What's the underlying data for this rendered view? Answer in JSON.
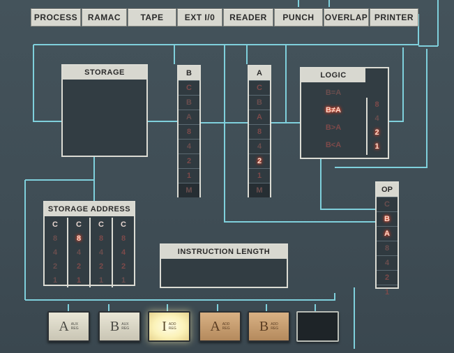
{
  "status_buttons": [
    "PROCESS",
    "RAMAC",
    "TAPE",
    "EXT I/0",
    "READER",
    "PUNCH",
    "OVERLAP",
    "PRINTER"
  ],
  "storage": {
    "label": "STORAGE"
  },
  "b_register": {
    "label": "B",
    "cells": [
      {
        "text": "C",
        "state": "off"
      },
      {
        "text": "B",
        "state": "dim"
      },
      {
        "text": "A",
        "state": "dim"
      },
      {
        "text": "8",
        "state": "off"
      },
      {
        "text": "4",
        "state": "dim"
      },
      {
        "text": "2",
        "state": "off"
      },
      {
        "text": "1",
        "state": "off"
      },
      {
        "text": "M",
        "state": "dim"
      }
    ]
  },
  "a_register": {
    "label": "A",
    "cells": [
      {
        "text": "C",
        "state": "off"
      },
      {
        "text": "B",
        "state": "dim"
      },
      {
        "text": "A",
        "state": "off"
      },
      {
        "text": "8",
        "state": "off"
      },
      {
        "text": "4",
        "state": "dim"
      },
      {
        "text": "2",
        "state": "on"
      },
      {
        "text": "1",
        "state": "off"
      },
      {
        "text": "M",
        "state": "dim"
      }
    ]
  },
  "logic": {
    "label": "LOGIC",
    "rows": [
      {
        "text": "B=A",
        "state": "dim"
      },
      {
        "text": "B≠A",
        "state": "on"
      },
      {
        "text": "B>A",
        "state": "off"
      },
      {
        "text": "B<A",
        "state": "off"
      }
    ],
    "side_cells": [
      {
        "text": "8",
        "state": "off"
      },
      {
        "text": "4",
        "state": "dim"
      },
      {
        "text": "2",
        "state": "on"
      },
      {
        "text": "1",
        "state": "on"
      }
    ]
  },
  "op": {
    "label": "OP",
    "cells": [
      {
        "text": "C",
        "state": "dim"
      },
      {
        "text": "B",
        "state": "on"
      },
      {
        "text": "A",
        "state": "on"
      },
      {
        "text": "8",
        "state": "dim"
      },
      {
        "text": "4",
        "state": "dim"
      },
      {
        "text": "2",
        "state": "off"
      },
      {
        "text": "1",
        "state": "off"
      }
    ]
  },
  "storage_address": {
    "label": "STORAGE ADDRESS",
    "columns": [
      {
        "header": "C",
        "cells": [
          {
            "text": "8",
            "state": "dim"
          },
          {
            "text": "4",
            "state": "dim"
          },
          {
            "text": "2",
            "state": "dim"
          },
          {
            "text": "1",
            "state": "dim"
          }
        ]
      },
      {
        "header": "C",
        "cells": [
          {
            "text": "8",
            "state": "on"
          },
          {
            "text": "4",
            "state": "dim"
          },
          {
            "text": "2",
            "state": "off"
          },
          {
            "text": "1",
            "state": "off"
          }
        ]
      },
      {
        "header": "C",
        "cells": [
          {
            "text": "8",
            "state": "off"
          },
          {
            "text": "4",
            "state": "dim"
          },
          {
            "text": "2",
            "state": "off"
          },
          {
            "text": "1",
            "state": "dim"
          }
        ]
      },
      {
        "header": "C",
        "cells": [
          {
            "text": "8",
            "state": "off"
          },
          {
            "text": "4",
            "state": "off"
          },
          {
            "text": "2",
            "state": "off"
          },
          {
            "text": "1",
            "state": "dim"
          }
        ]
      }
    ]
  },
  "instruction_length": {
    "label": "INSTRUCTION LENGTH"
  },
  "keys": [
    {
      "big": "A",
      "small1": "AUX",
      "small2": "REG",
      "style": "pale"
    },
    {
      "big": "B",
      "small1": "AUX",
      "small2": "REG",
      "style": "pale"
    },
    {
      "big": "I",
      "small1": "ADD",
      "small2": "REG",
      "style": "lit"
    },
    {
      "big": "A",
      "small1": "ADD",
      "small2": "REG",
      "style": "tan"
    },
    {
      "big": "B",
      "small1": "ADD",
      "small2": "REG",
      "style": "tan"
    },
    {
      "big": "",
      "small1": "",
      "small2": "",
      "style": "blank"
    }
  ],
  "colors": {
    "panel": "#3f4d55",
    "line": "#7fd0dc",
    "lamp_on": "#ff4a2a",
    "label_bg": "#d8d8d0"
  }
}
